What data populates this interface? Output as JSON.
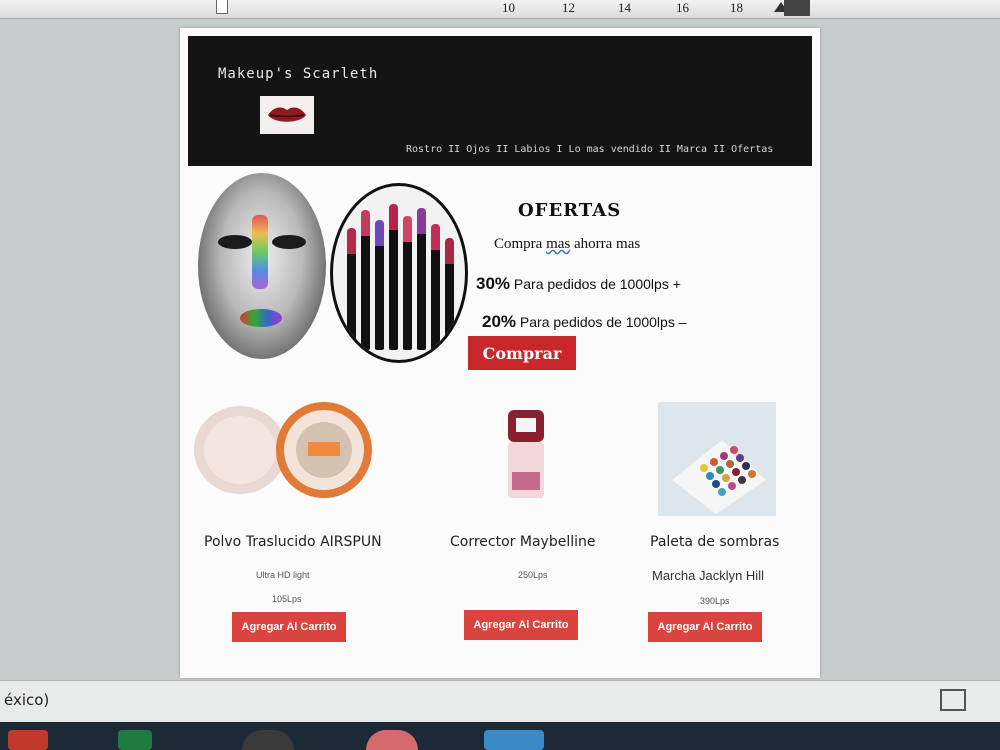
{
  "ruler": {
    "numbers": [
      "10",
      "12",
      "14",
      "16",
      "18"
    ]
  },
  "site": {
    "brand": "Makeup's Scarleth",
    "nav": "Rostro II Ojos II Labios I Lo mas vendido II Marca II Ofertas"
  },
  "offers": {
    "title": "OFERTAS",
    "subtitle_pre": "Compra ",
    "subtitle_mid": "mas",
    "subtitle_post": " ahorra mas",
    "line1_pct": "30%",
    "line1_text": " Para pedidos de 1000lps +",
    "line2_pct": "20%",
    "line2_text": " Para pedidos de 1000lps –",
    "button": "Comprar"
  },
  "products": [
    {
      "name": "Polvo Traslucido AIRSPUN",
      "detail": "Ultra HD light",
      "price": "105Lps",
      "button": "Agregar Al Carrito"
    },
    {
      "name": "Corrector Maybelline",
      "detail": "",
      "price": "250Lps",
      "button": "Agregar Al Carrito"
    },
    {
      "name": "Paleta de sombras",
      "detail": "Marcha Jacklyn Hill",
      "price": "390Lps",
      "button": "Agregar Al Carrito"
    }
  ],
  "status": {
    "language": "éxico)"
  }
}
